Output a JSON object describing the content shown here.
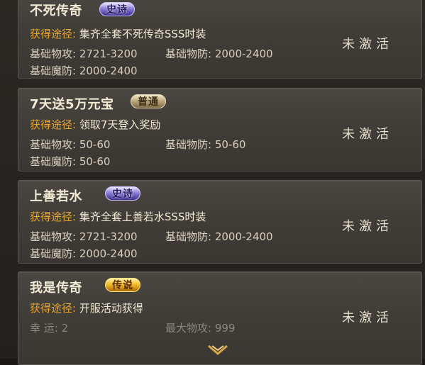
{
  "cards": [
    {
      "title": "不死传奇",
      "badge": "史诗",
      "badge_type": "epic",
      "source_label": "获得途径:",
      "source_value": "集齐全套不死传奇SSS时装",
      "stat1": "基础物攻: 2721-3200",
      "stat2": "基础物防: 2000-2400",
      "stat3": "基础魔防: 2000-2400",
      "status": "未激活"
    },
    {
      "title": "7天送5万元宝",
      "badge": "普通",
      "badge_type": "normal",
      "source_label": "获得途径:",
      "source_value": "领取7天登入奖励",
      "stat1": "基础物攻: 50-60",
      "stat2": "基础物防: 50-60",
      "stat3": "基础魔防: 50-60",
      "status": "未激活"
    },
    {
      "title": "上善若水",
      "badge": "史诗",
      "badge_type": "epic",
      "source_label": "获得途径:",
      "source_value": "集齐全套上善若水SSS时装",
      "stat1": "基础物攻: 2721-3200",
      "stat2": "基础物防: 2000-2400",
      "stat3": "基础魔防: 2000-2400",
      "status": "未激活"
    },
    {
      "title": "我是传奇",
      "badge": "传说",
      "badge_type": "legend",
      "source_label": "获得途径:",
      "source_value": "开服活动获得",
      "stat1": "幸   运: 2",
      "stat2": "最大物攻: 999",
      "status": "未激活"
    }
  ],
  "colors": {
    "label_orange": "#e7a732",
    "text_cream": "#f1ead5",
    "epic_purple": "#8c7fd9",
    "normal_tan": "#bba57a",
    "legend_gold": "#f3be2a"
  },
  "icons": {
    "scroll": "chevron-down-icon"
  }
}
